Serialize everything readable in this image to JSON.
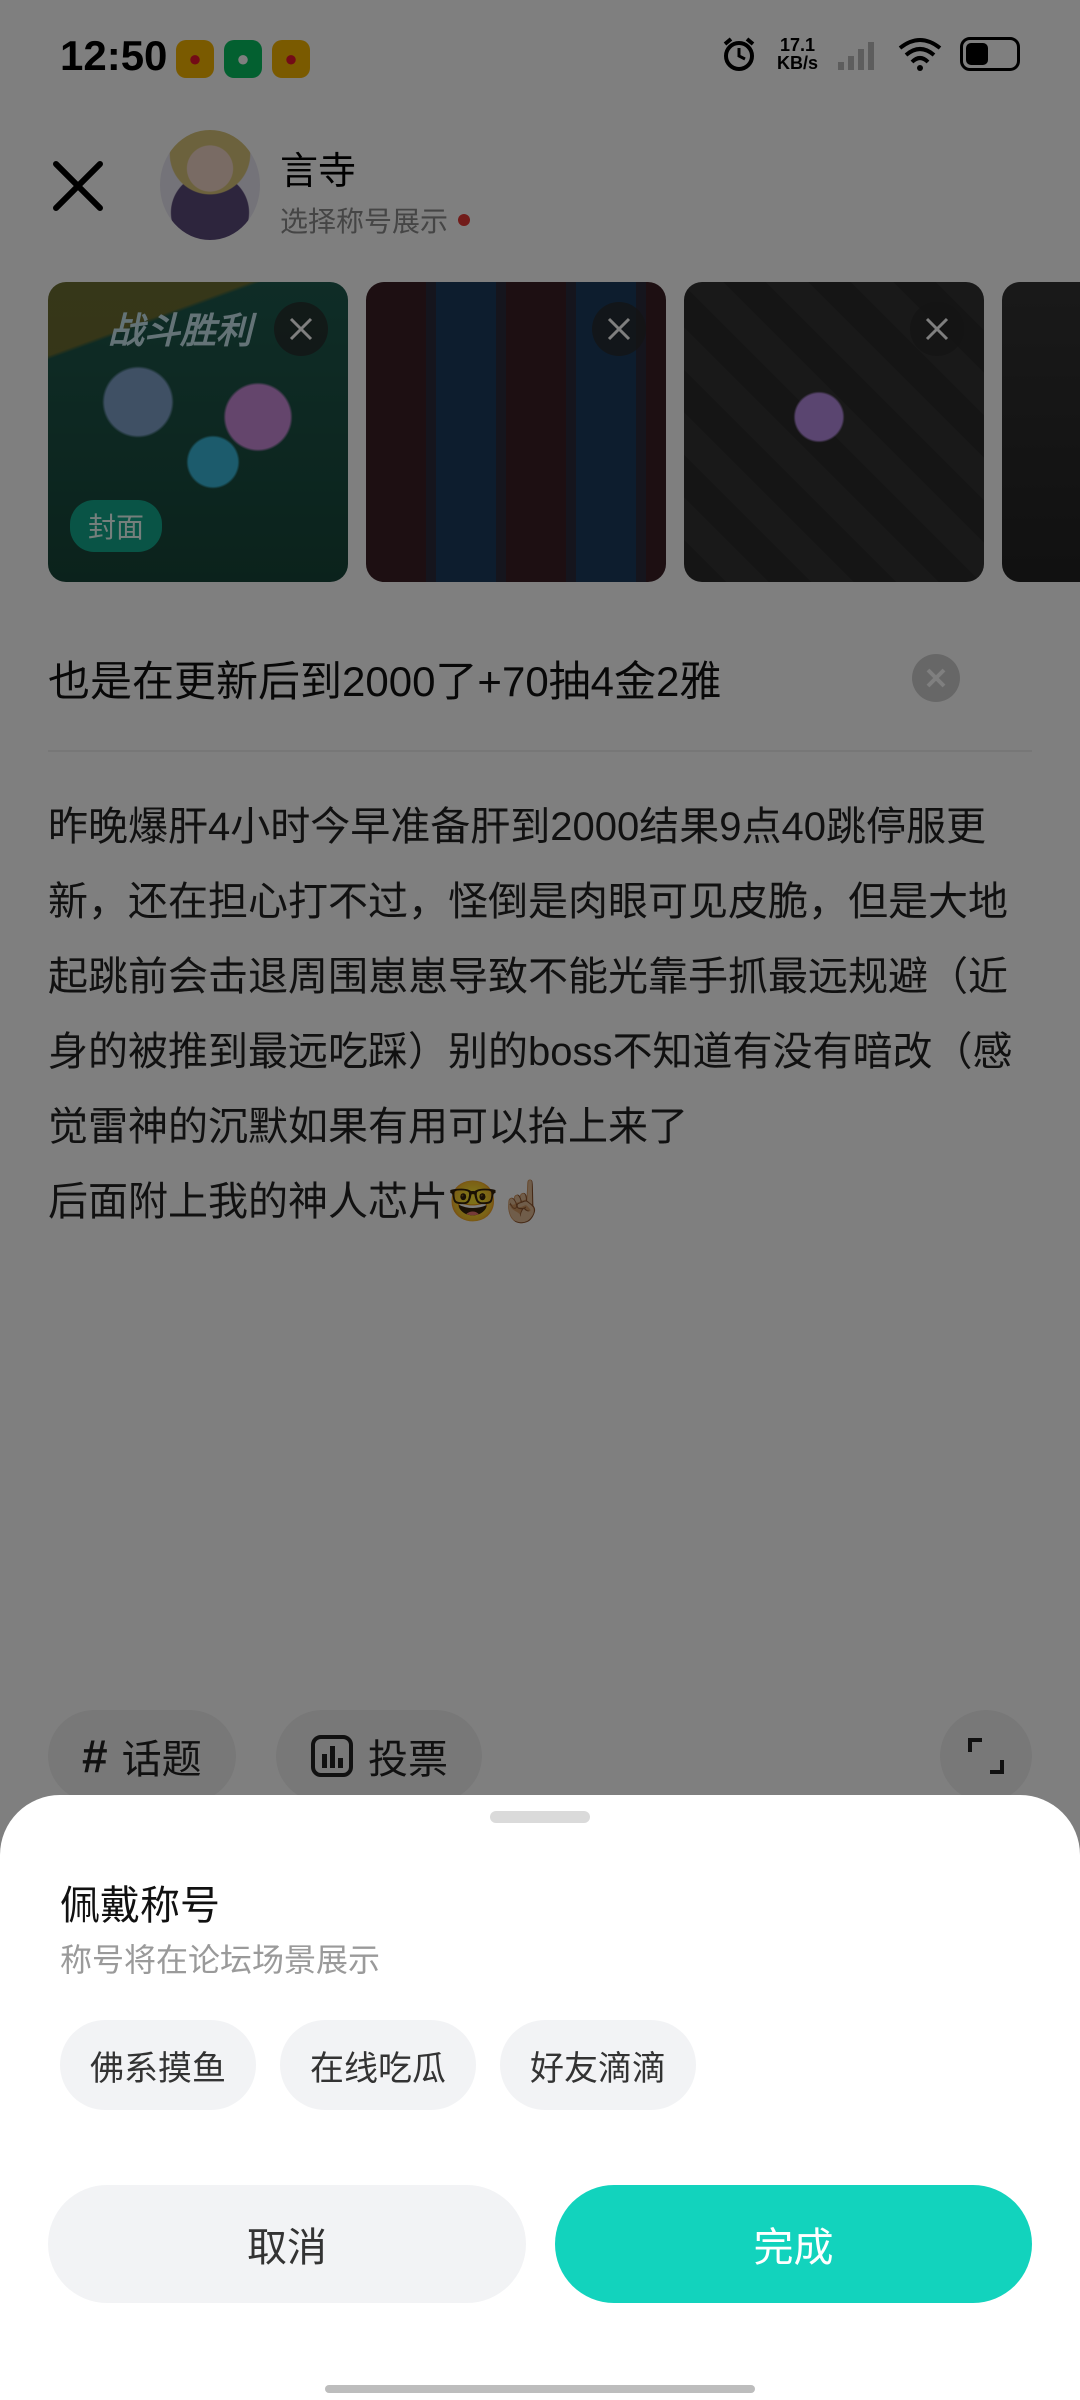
{
  "status_bar": {
    "time": "12:50",
    "net_speed_value": "17.1",
    "net_speed_unit": "KB/s",
    "icons": [
      "weibo-icon",
      "wechat-icon",
      "weibo-icon",
      "alarm-icon",
      "signal-icon",
      "wifi-icon",
      "battery-icon"
    ],
    "battery_level_fraction": 0.45
  },
  "header": {
    "username": "言寺",
    "title_prompt": "选择称号展示"
  },
  "photos": {
    "cover_label": "封面",
    "first_banner_text": "战斗胜利"
  },
  "post": {
    "title": "也是在更新后到2000了+70抽4金2雅",
    "body": "昨晚爆肝4小时今早准备肝到2000结果9点40跳停服更新，还在担心打不过，怪倒是肉眼可见皮脆，但是大地起跳前会击退周围崽崽导致不能光靠手抓最远规避（近身的被推到最远吃踩）别的boss不知道有没有暗改（感觉雷神的沉默如果有用可以抬上来了\n后面附上我的神人芯片🤓☝🏼"
  },
  "toolbar": {
    "topic_label": "话题",
    "vote_label": "投票"
  },
  "sheet": {
    "title": "佩戴称号",
    "subtitle": "称号将在论坛场景展示",
    "options": [
      "佛系摸鱼",
      "在线吃瓜",
      "好友滴滴"
    ],
    "cancel_label": "取消",
    "done_label": "完成"
  },
  "colors": {
    "accent": "#12d3bd",
    "cover_badge": "#12a88c",
    "red_dot": "#e53935"
  }
}
